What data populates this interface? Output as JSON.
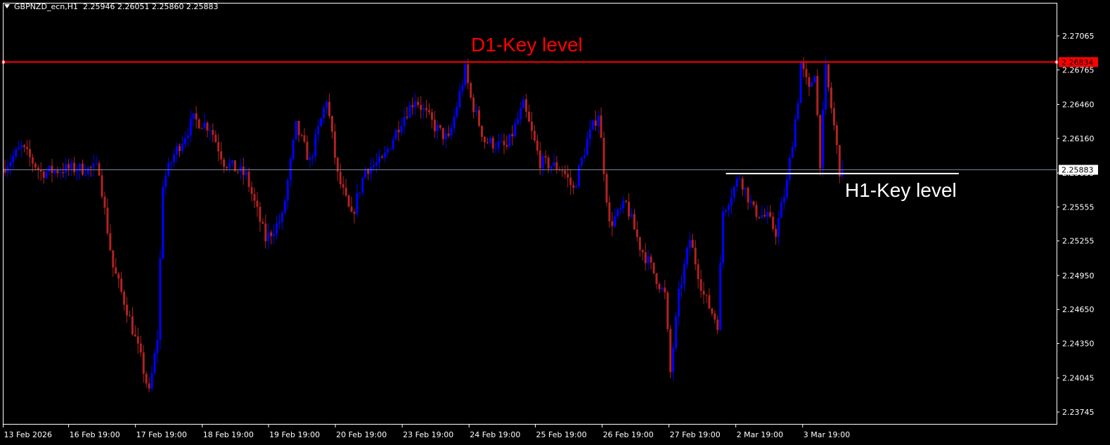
{
  "header": {
    "symbol": "GBPNZD_ecn,H1",
    "open": "2.25946",
    "high": "2.26051",
    "low": "2.25860",
    "close": "2.25883"
  },
  "annotations": {
    "d1_label": "D1-Key level",
    "h1_label": "H1-Key level"
  },
  "colors": {
    "background": "#000000",
    "bull": "#0000ff",
    "bear": "#b22222",
    "d1_line": "#ff0000",
    "h1_line": "#ffffff",
    "bid_line": "#778899",
    "axis": "#ffffff"
  },
  "chart_data": {
    "type": "candlestick",
    "title": "GBPNZD_ecn,H1",
    "ylim": [
      2.2364,
      2.27357
    ],
    "total_slots": 380,
    "y_ticks": [
      "2.27065",
      "2.26765",
      "2.26460",
      "2.26160",
      "2.25855",
      "2.25555",
      "2.25255",
      "2.24950",
      "2.24650",
      "2.24350",
      "2.24045",
      "2.23745"
    ],
    "x_ticks": [
      {
        "index": 0,
        "label": "13 Feb 2026"
      },
      {
        "index": 23.6,
        "label": "16 Feb 19:00"
      },
      {
        "index": 47.7,
        "label": "17 Feb 19:00"
      },
      {
        "index": 71.8,
        "label": "18 Feb 19:00"
      },
      {
        "index": 95.7,
        "label": "19 Feb 19:00"
      },
      {
        "index": 119.8,
        "label": "20 Feb 19:00"
      },
      {
        "index": 143.9,
        "label": "23 Feb 19:00"
      },
      {
        "index": 168,
        "label": "24 Feb 19:00"
      },
      {
        "index": 191.9,
        "label": "25 Feb 19:00"
      },
      {
        "index": 216,
        "label": "26 Feb 19:00"
      },
      {
        "index": 240.1,
        "label": "27 Feb 19:00"
      },
      {
        "index": 264.2,
        "label": "2 Mar 19:00"
      },
      {
        "index": 288.3,
        "label": "3 Mar 19:00"
      }
    ],
    "price_path": [
      [
        0,
        2.25892
      ],
      [
        7,
        2.26078
      ],
      [
        14,
        2.25861
      ],
      [
        24,
        2.25892
      ],
      [
        35,
        2.25892
      ],
      [
        37,
        2.2552
      ],
      [
        40,
        2.25023
      ],
      [
        45,
        2.24651
      ],
      [
        50,
        2.24216
      ],
      [
        53,
        2.23906
      ],
      [
        56,
        2.24403
      ],
      [
        58,
        2.25768
      ],
      [
        62,
        2.26016
      ],
      [
        69,
        2.26326
      ],
      [
        75,
        2.26264
      ],
      [
        80,
        2.25954
      ],
      [
        88,
        2.2583
      ],
      [
        95,
        2.25271
      ],
      [
        101,
        2.25458
      ],
      [
        106,
        2.26264
      ],
      [
        111,
        2.25954
      ],
      [
        117,
        2.26513
      ],
      [
        121,
        2.2583
      ],
      [
        126,
        2.25458
      ],
      [
        131,
        2.25892
      ],
      [
        137,
        2.25954
      ],
      [
        144,
        2.26326
      ],
      [
        149,
        2.26513
      ],
      [
        156,
        2.26264
      ],
      [
        161,
        2.2614
      ],
      [
        167,
        2.26761
      ],
      [
        169,
        2.26513
      ],
      [
        174,
        2.2614
      ],
      [
        182,
        2.26078
      ],
      [
        188,
        2.26451
      ],
      [
        194,
        2.25954
      ],
      [
        202,
        2.25892
      ],
      [
        206,
        2.25706
      ],
      [
        211,
        2.2614
      ],
      [
        215,
        2.26389
      ],
      [
        217,
        2.25892
      ],
      [
        219,
        2.25396
      ],
      [
        225,
        2.25582
      ],
      [
        230,
        2.25209
      ],
      [
        234,
        2.25023
      ],
      [
        239,
        2.24775
      ],
      [
        241,
        2.24092
      ],
      [
        244,
        2.24775
      ],
      [
        248,
        2.25271
      ],
      [
        253,
        2.24775
      ],
      [
        258,
        2.24527
      ],
      [
        260,
        2.2552
      ],
      [
        266,
        2.2583
      ],
      [
        271,
        2.2552
      ],
      [
        276,
        2.25458
      ],
      [
        279,
        2.25334
      ],
      [
        283,
        2.25768
      ],
      [
        287,
        2.26513
      ],
      [
        288,
        2.26823
      ],
      [
        291,
        2.26575
      ],
      [
        293,
        2.26761
      ],
      [
        295,
        2.25954
      ],
      [
        297,
        2.26761
      ],
      [
        300,
        2.26264
      ],
      [
        302,
        2.25883
      ]
    ],
    "levels": {
      "d1_key": {
        "price": 2.26834,
        "label": "2.26834"
      },
      "h1_key": {
        "price": 2.2585,
        "from_index": 260,
        "to_index": 344
      },
      "bid": {
        "price": 2.25883,
        "label": "2.25883"
      }
    }
  }
}
